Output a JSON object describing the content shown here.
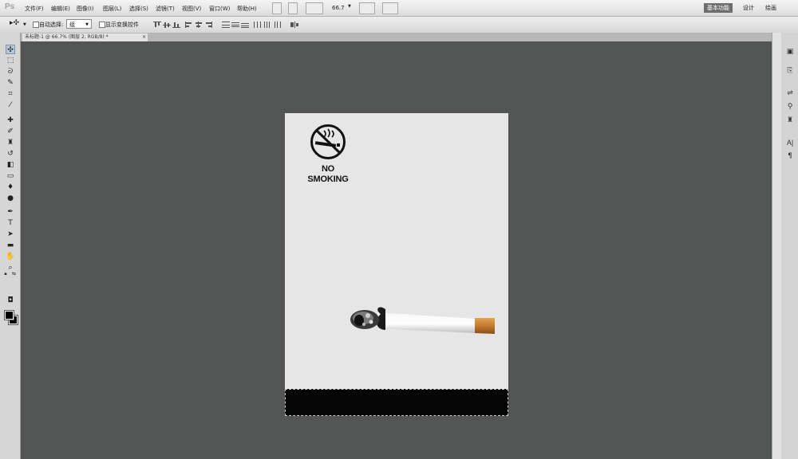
{
  "app": {
    "logo": "Ps"
  },
  "menu": [
    "文件(F)",
    "编辑(E)",
    "图像(I)",
    "图层(L)",
    "选择(S)",
    "滤镜(T)",
    "视图(V)",
    "窗口(W)",
    "帮助(H)"
  ],
  "zoom": {
    "value": "66.7"
  },
  "workspaces": [
    "基本功能",
    "设计",
    "绘画"
  ],
  "options": {
    "auto_select_label": "自动选择:",
    "auto_select_value": "组",
    "show_transform_label": "显示变换控件"
  },
  "document": {
    "tab_title": "未标题-1 @ 66.7% (图层 2, RGB/8) *",
    "close": "×"
  },
  "poster": {
    "line1": "NO",
    "line2": "SMOKING"
  }
}
